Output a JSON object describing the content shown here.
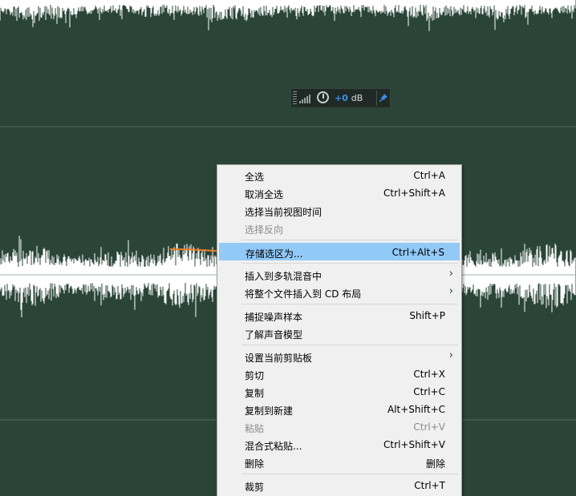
{
  "hud": {
    "volume_value": "+0",
    "volume_unit": "dB",
    "icons": [
      "grip-icon",
      "level-bars-icon",
      "volume-knob-icon",
      "pin-icon"
    ]
  },
  "colors": {
    "background": "#2a4538",
    "waveform": "#ffffff",
    "highlight": "#91c9f7",
    "arrow": "#f07f24",
    "volume_text": "#3b8ee8"
  },
  "menu": {
    "items": [
      {
        "label": "全选",
        "shortcut": "Ctrl+A"
      },
      {
        "label": "取消全选",
        "shortcut": "Ctrl+Shift+A"
      },
      {
        "label": "选择当前视图时间",
        "shortcut": ""
      },
      {
        "label": "选择反向",
        "shortcut": "",
        "disabled": true
      },
      {
        "label": "存储选区为...",
        "shortcut": "Ctrl+Alt+S",
        "highlighted": true
      },
      {
        "label": "插入到多轨混音中",
        "submenu": true
      },
      {
        "label": "将整个文件插入到 CD 布局",
        "submenu": true
      },
      {
        "label": "捕捉噪声样本",
        "shortcut": "Shift+P"
      },
      {
        "label": "了解声音模型",
        "shortcut": ""
      },
      {
        "label": "设置当前剪贴板",
        "submenu": true
      },
      {
        "label": "剪切",
        "shortcut": "Ctrl+X"
      },
      {
        "label": "复制",
        "shortcut": "Ctrl+C"
      },
      {
        "label": "复制到新建",
        "shortcut": "Alt+Shift+C"
      },
      {
        "label": "粘贴",
        "shortcut": "Ctrl+V",
        "disabled": true
      },
      {
        "label": "混合式粘贴...",
        "shortcut": "Ctrl+Shift+V"
      },
      {
        "label": "删除",
        "shortcut": "删除"
      },
      {
        "label": "裁剪",
        "shortcut": "Ctrl+T"
      }
    ]
  }
}
